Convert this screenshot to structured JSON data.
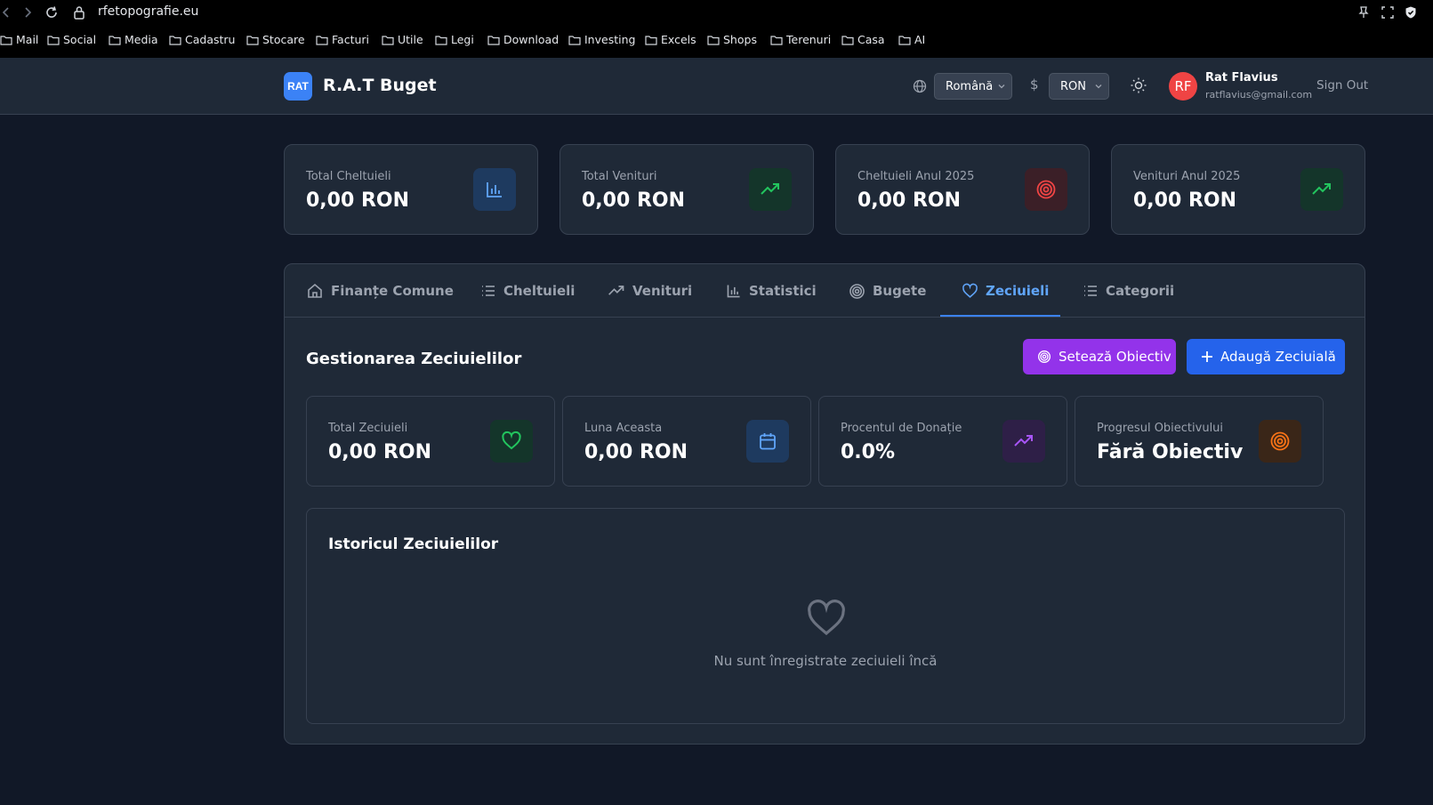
{
  "browser": {
    "url": "rfetopografie.eu",
    "bookmarks": [
      "Mail",
      "Social",
      "Media",
      "Cadastru",
      "Stocare",
      "Facturi",
      "Utile",
      "Legi",
      "Download",
      "Investing",
      "Excels",
      "Shops",
      "Terenuri",
      "Casa",
      "AI"
    ]
  },
  "header": {
    "logo_text": "RAT",
    "app_title": "R.A.T Buget",
    "language": "Română",
    "currency_symbol": "$",
    "currency": "RON",
    "avatar_initials": "RF",
    "user_name": "Rat Flavius",
    "user_email": "ratflavius@gmail.com",
    "sign_out": "Sign Out"
  },
  "stats": [
    {
      "label": "Total Cheltuieli",
      "value": "0,00 RON",
      "icon": "bar-chart-icon",
      "color": "#60a5fa"
    },
    {
      "label": "Total Venituri",
      "value": "0,00 RON",
      "icon": "trending-up-icon",
      "color": "#22c55e"
    },
    {
      "label": "Cheltuieli Anul 2025",
      "value": "0,00 RON",
      "icon": "target-icon",
      "color": "#ef4444"
    },
    {
      "label": "Venituri Anul 2025",
      "value": "0,00 RON",
      "icon": "trending-up-icon",
      "color": "#22c55e"
    }
  ],
  "tabs": [
    {
      "label": "Finanțe Comune",
      "icon": "home-icon"
    },
    {
      "label": "Cheltuieli",
      "icon": "list-icon"
    },
    {
      "label": "Venituri",
      "icon": "trending-up-icon"
    },
    {
      "label": "Statistici",
      "icon": "bar-chart-icon"
    },
    {
      "label": "Bugete",
      "icon": "target-icon"
    },
    {
      "label": "Zeciuieli",
      "icon": "heart-icon",
      "active": true
    },
    {
      "label": "Categorii",
      "icon": "list-icon"
    }
  ],
  "tithes": {
    "title": "Gestionarea Zeciuielilor",
    "set_goal_button": "Setează Obiectiv",
    "add_button": "Adaugă Zeciuială",
    "cards": [
      {
        "label": "Total Zeciuieli",
        "value": "0,00 RON",
        "icon": "heart-icon",
        "color": "#22c55e"
      },
      {
        "label": "Luna Aceasta",
        "value": "0,00 RON",
        "icon": "calendar-icon",
        "color": "#60a5fa"
      },
      {
        "label": "Procentul de Donație",
        "value": "0.0%",
        "icon": "trending-up-icon",
        "color": "#a855f7"
      },
      {
        "label": "Progresul Obiectivului",
        "value": "Fără Obiectiv",
        "icon": "target-icon",
        "color": "#f97316"
      }
    ],
    "history_title": "Istoricul Zeciuielilor",
    "empty_text": "Nu sunt înregistrate zeciuieli încă"
  },
  "colors": {
    "background": "#111827",
    "card": "#1f2937",
    "border": "#374151",
    "accent_blue": "#3b82f6",
    "accent_purple": "#9333ea"
  }
}
